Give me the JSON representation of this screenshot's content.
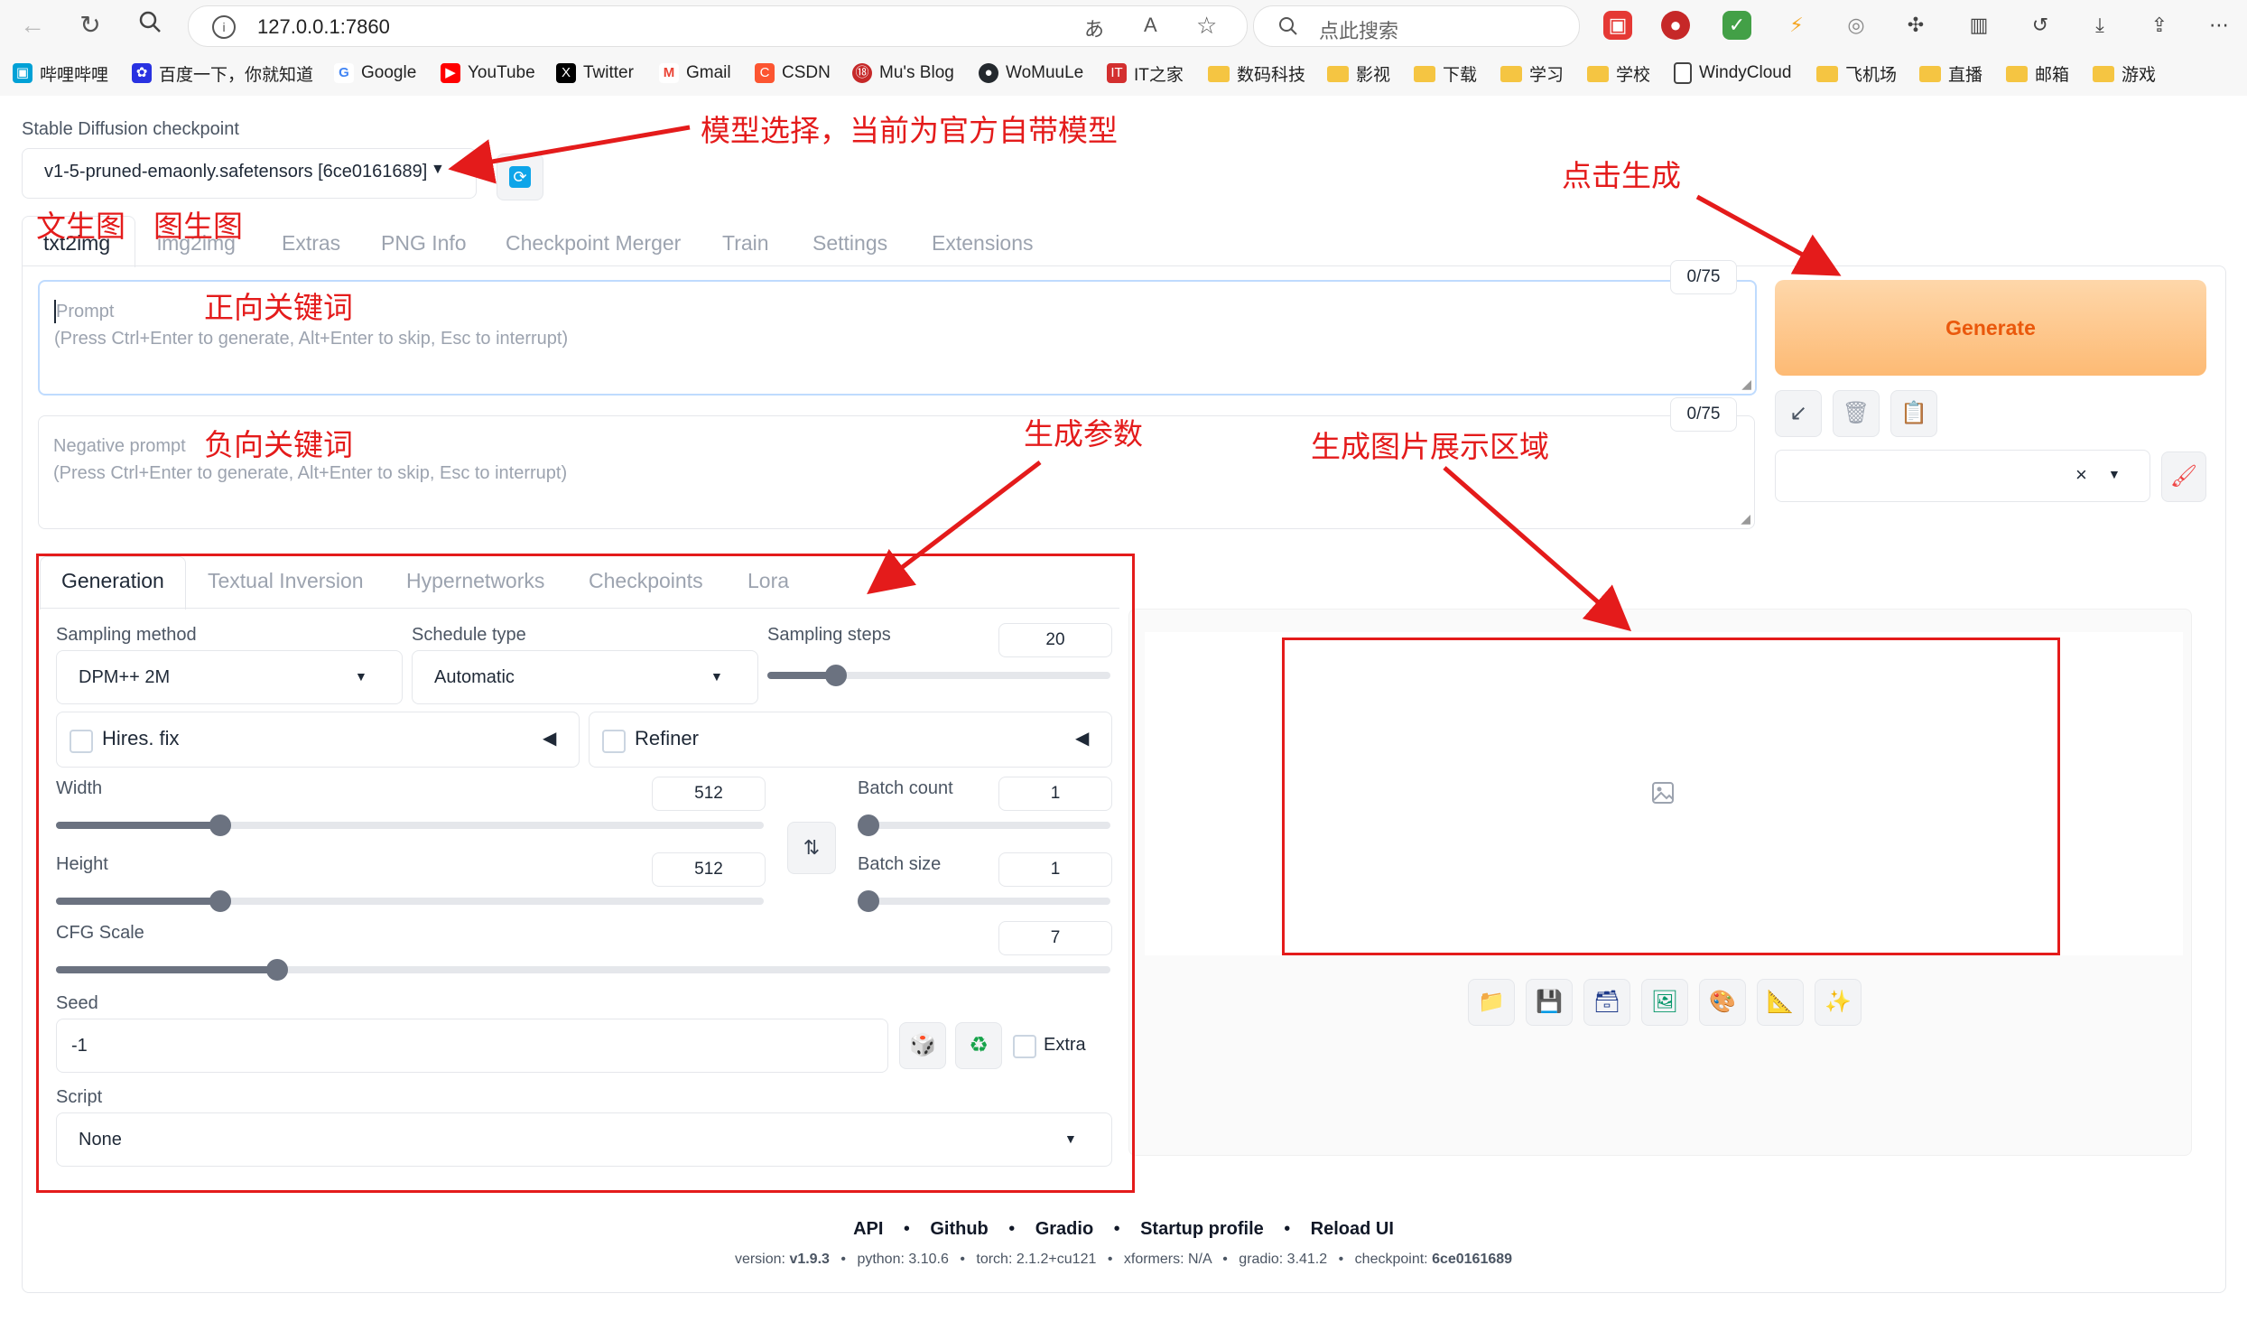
{
  "browser": {
    "url": "127.0.0.1:7860",
    "search_placeholder": "点此搜索",
    "bookmarks": [
      "哔哩哔哩",
      "百度一下，你就知道",
      "Google",
      "YouTube",
      "Twitter",
      "Gmail",
      "CSDN",
      "Mu's Blog",
      "WoMuuLe",
      "IT之家",
      "数码科技",
      "影视",
      "下载",
      "学习",
      "学校",
      "WindyCloud",
      "飞机场",
      "直播",
      "邮箱",
      "游戏"
    ],
    "more_chevron": "›"
  },
  "checkpoint": {
    "label": "Stable Diffusion checkpoint",
    "value": "v1-5-pruned-emaonly.safetensors [6ce0161689]"
  },
  "main_tabs": [
    "txt2img",
    "img2img",
    "Extras",
    "PNG Info",
    "Checkpoint Merger",
    "Train",
    "Settings",
    "Extensions"
  ],
  "prompt": {
    "placeholder_title": "Prompt",
    "placeholder_hint": "(Press Ctrl+Enter to generate, Alt+Enter to skip, Esc to interrupt)",
    "counter": "0/75"
  },
  "negative_prompt": {
    "placeholder_title": "Negative prompt",
    "placeholder_hint": "(Press Ctrl+Enter to generate, Alt+Enter to skip, Esc to interrupt)",
    "counter": "0/75"
  },
  "generate_label": "Generate",
  "style_clear": "×",
  "sub_tabs": [
    "Generation",
    "Textual Inversion",
    "Hypernetworks",
    "Checkpoints",
    "Lora"
  ],
  "params": {
    "sampling_method_label": "Sampling method",
    "sampling_method_value": "DPM++ 2M",
    "schedule_type_label": "Schedule type",
    "schedule_type_value": "Automatic",
    "sampling_steps_label": "Sampling steps",
    "sampling_steps_value": "20",
    "sampling_steps_fraction": 0.2,
    "hires_label": "Hires. fix",
    "refiner_label": "Refiner",
    "width_label": "Width",
    "width_value": "512",
    "width_fraction": 0.232,
    "height_label": "Height",
    "height_value": "512",
    "height_fraction": 0.232,
    "batch_count_label": "Batch count",
    "batch_count_value": "1",
    "batch_count_fraction": 0.0,
    "batch_size_label": "Batch size",
    "batch_size_value": "1",
    "batch_size_fraction": 0.0,
    "cfg_label": "CFG Scale",
    "cfg_value": "7",
    "cfg_fraction": 0.21,
    "seed_label": "Seed",
    "seed_value": "-1",
    "extra_label": "Extra",
    "script_label": "Script",
    "script_value": "None"
  },
  "annotations": {
    "model": "模型选择，当前为官方自带模型",
    "txt2img": "文生图",
    "img2img": "图生图",
    "generate": "点击生成",
    "positive": "正向关键词",
    "negative": "负向关键词",
    "params": "生成参数",
    "gallery": "生成图片展示区域"
  },
  "footer": {
    "links": [
      "API",
      "Github",
      "Gradio",
      "Startup profile",
      "Reload UI"
    ],
    "version_label": "version:",
    "version": "v1.9.3",
    "python": "python: 3.10.6",
    "torch": "torch: 2.1.2+cu121",
    "xformers": "xformers: N/A",
    "gradio": "gradio: 3.41.2",
    "checkpoint_label": "checkpoint:",
    "checkpoint": "6ce0161689"
  },
  "colors": {
    "accent_orange": "#fb923c",
    "annotation_red": "#e41b1b"
  }
}
